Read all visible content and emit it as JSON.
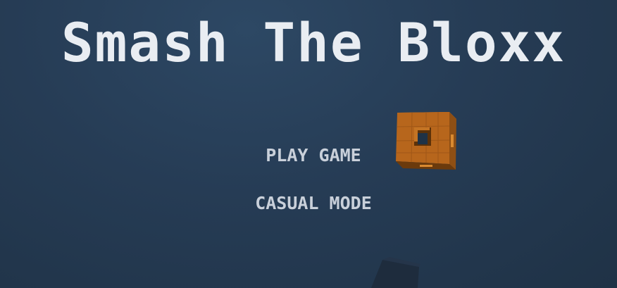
{
  "game": {
    "title": "Smash The Bloxx"
  },
  "menu": {
    "play_label": "PLAY GAME",
    "casual_label": "CASUAL MODE"
  },
  "colors": {
    "background": "#263c55",
    "title_text": "#e9edf2",
    "menu_text": "#c9d0da",
    "cube_orange": "#b7661c"
  }
}
